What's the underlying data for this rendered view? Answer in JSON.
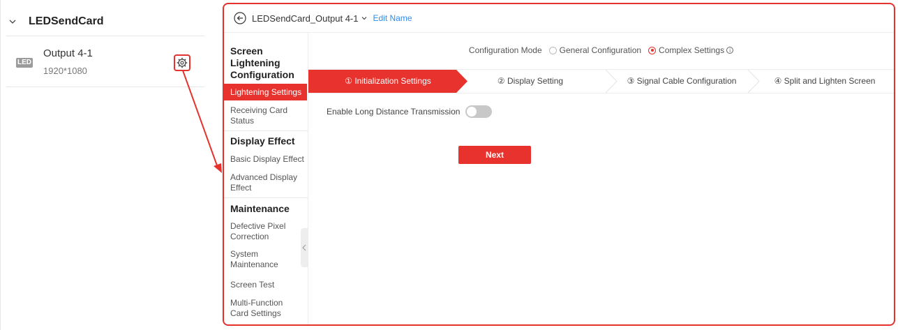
{
  "device_panel": {
    "group_name": "LEDSendCard",
    "output": {
      "icon_text": "LED",
      "name": "Output 4-1",
      "resolution": "1920*1080"
    }
  },
  "header": {
    "title": "LEDSendCard_Output 4-1",
    "edit_label": "Edit Name"
  },
  "menu": {
    "section_screen": "Screen Lightening Configuration",
    "lightening_settings": "Lightening Settings",
    "receiving_card_status": "Receiving Card Status",
    "section_display": "Display Effect",
    "basic_display": "Basic Display Effect",
    "advanced_display": "Advanced Display Effect",
    "section_maintenance": "Maintenance",
    "defective_pixel": "Defective Pixel Correction",
    "system_maintenance": "System Maintenance",
    "screen_test": "Screen Test",
    "multi_function": "Multi-Function Card Settings"
  },
  "config_mode": {
    "label": "Configuration Mode",
    "option_general": "General Configuration",
    "option_complex": "Complex Settings",
    "selected": "Complex Settings"
  },
  "steps": [
    {
      "label": "① Initialization Settings"
    },
    {
      "label": "② Display Setting"
    },
    {
      "label": "③ Signal Cable Configuration"
    },
    {
      "label": "④ Split and Lighten Screen"
    }
  ],
  "form": {
    "long_distance_label": "Enable Long Distance Transmission",
    "long_distance_on": false
  },
  "next_label": "Next",
  "colors": {
    "accent": "#e8322d",
    "link": "#2d8cf0"
  }
}
